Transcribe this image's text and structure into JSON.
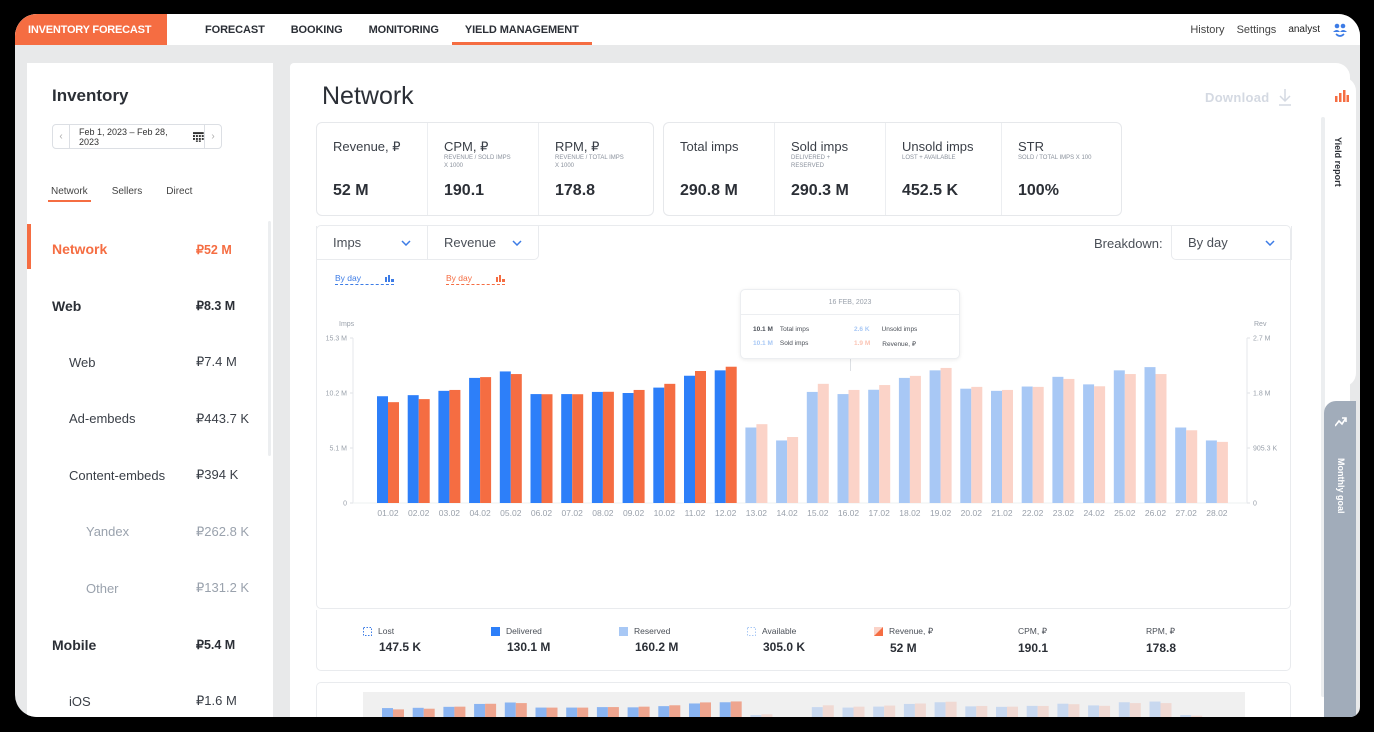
{
  "topnav": {
    "brand": "INVENTORY FORECAST",
    "tabs": [
      {
        "label": "FORECAST",
        "active": false
      },
      {
        "label": "BOOKING",
        "active": false
      },
      {
        "label": "MONITORING",
        "active": false
      },
      {
        "label": "YIELD MANAGEMENT",
        "active": true
      }
    ],
    "history": "History",
    "settings": "Settings",
    "user": "analyst",
    "user_icon": "users-icon"
  },
  "colors": {
    "accent": "#f56d42",
    "imps_actual": "#2d7ff9",
    "revenue_actual": "#f56d42",
    "imps_forecast": "#a8c8f5",
    "revenue_forecast": "#fbd3c8",
    "rail_goal": "#a1acba"
  },
  "sidebar": {
    "title": "Inventory",
    "date_range": "Feb 1, 2023 – Feb 28, 2023",
    "prev_icon": "chevron-left-icon",
    "next_icon": "chevron-right-icon",
    "calendar_icon": "calendar-icon",
    "tabs": [
      {
        "label": "Network",
        "active": true
      },
      {
        "label": "Sellers",
        "active": false
      },
      {
        "label": "Direct",
        "active": false
      }
    ],
    "items": [
      {
        "label": "Network",
        "value": "₽52 M",
        "level": 0,
        "active": true
      },
      {
        "label": "Web",
        "value": "₽8.3 M",
        "level": 0,
        "active": false
      },
      {
        "label": "Web",
        "value": "₽7.4 M",
        "level": 1,
        "active": false
      },
      {
        "label": "Ad-embeds",
        "value": "₽443.7 K",
        "level": 1,
        "active": false
      },
      {
        "label": "Content-embeds",
        "value": "₽394 K",
        "level": 1,
        "active": false
      },
      {
        "label": "Yandex",
        "value": "₽262.8 K",
        "level": 2,
        "active": false
      },
      {
        "label": "Other",
        "value": "₽131.2 K",
        "level": 2,
        "active": false
      },
      {
        "label": "Mobile",
        "value": "₽5.4 M",
        "level": 0,
        "active": false
      },
      {
        "label": "iOS",
        "value": "₽1.6 M",
        "level": 1,
        "active": false
      }
    ]
  },
  "main": {
    "title": "Network",
    "download": "Download",
    "kpi_left": [
      {
        "label": "Revenue, ₽",
        "sub": "",
        "value": "52 M"
      },
      {
        "label": "CPM, ₽",
        "sub": "REVENUE / SOLD IMPS X 1000",
        "value": "190.1"
      },
      {
        "label": "RPM, ₽",
        "sub": "REVENUE / TOTAL IMPS X 1000",
        "value": "178.8"
      }
    ],
    "kpi_right": [
      {
        "label": "Total imps",
        "sub": "",
        "value": "290.8 M"
      },
      {
        "label": "Sold imps",
        "sub": "DELIVERED + RESERVED",
        "value": "290.3 M"
      },
      {
        "label": "Unsold imps",
        "sub": "LOST + AVAILABLE",
        "value": "452.5 K"
      },
      {
        "label": "STR",
        "sub": "SOLD / TOTAL IMPS X 100",
        "value": "100%"
      }
    ],
    "selectors": {
      "metric1": "Imps",
      "metric2": "Revenue",
      "breakdown_label": "Breakdown:",
      "breakdown_value": "By day",
      "link1": "By day",
      "link2": "By day"
    },
    "tooltip": {
      "date": "16 FEB, 2023",
      "total_imps_value": "10.1 M",
      "total_imps_label": "Total imps",
      "sold_imps_value": "10.1 M",
      "sold_imps_label": "Sold imps",
      "unsold_imps_value": "2.6 K",
      "unsold_imps_label": "Unsold imps",
      "revenue_value": "1.9 M",
      "revenue_label": "Revenue, ₽"
    },
    "legend": [
      {
        "label": "Lost",
        "value": "147.5 K",
        "swatch": "dotted-blue"
      },
      {
        "label": "Delivered",
        "value": "130.1 M",
        "swatch": "solid-blue"
      },
      {
        "label": "Reserved",
        "value": "160.2 M",
        "swatch": "light-blue"
      },
      {
        "label": "Available",
        "value": "305.0 K",
        "swatch": "dotted-light"
      },
      {
        "label": "Revenue, ₽",
        "value": "52 M",
        "swatch": "orange-triangle"
      },
      {
        "label": "CPM, ₽",
        "value": "190.1",
        "swatch": "none"
      },
      {
        "label": "RPM, ₽",
        "value": "178.8",
        "swatch": "none"
      }
    ]
  },
  "rail": {
    "yield_report": "Yield report",
    "monthly_goal": "Monthly goal"
  },
  "chart_data": {
    "type": "bar",
    "title": "",
    "xlabel": "",
    "ylabel": "Imps",
    "y2label": "Rev",
    "ylim": [
      0,
      15.3
    ],
    "y2lim": [
      0,
      2.7
    ],
    "yticks": [
      "0",
      "5.1 M",
      "10.2 M",
      "15.3 M"
    ],
    "y2ticks": [
      "0",
      "905.3 K",
      "1.8 M",
      "2.7 M"
    ],
    "categories": [
      "01.02",
      "02.02",
      "03.02",
      "04.02",
      "05.02",
      "06.02",
      "07.02",
      "08.02",
      "09.02",
      "10.02",
      "11.02",
      "12.02",
      "13.02",
      "14.02",
      "15.02",
      "16.02",
      "17.02",
      "18.02",
      "19.02",
      "20.02",
      "21.02",
      "22.02",
      "23.02",
      "24.02",
      "25.02",
      "26.02",
      "27.02",
      "28.02"
    ],
    "actual_count": 12,
    "series": [
      {
        "name": "Imps (M)",
        "axis": "left",
        "values": [
          9.9,
          10.0,
          10.4,
          11.6,
          12.2,
          10.1,
          10.1,
          10.3,
          10.2,
          10.7,
          11.8,
          12.3,
          7.0,
          5.8,
          10.3,
          10.1,
          10.5,
          11.6,
          12.3,
          10.6,
          10.4,
          10.8,
          11.7,
          11.0,
          12.3,
          12.6,
          7.0,
          5.8
        ]
      },
      {
        "name": "Revenue, ₽ (M)",
        "axis": "right",
        "values": [
          1.65,
          1.7,
          1.85,
          2.06,
          2.11,
          1.78,
          1.78,
          1.82,
          1.85,
          1.95,
          2.16,
          2.23,
          1.29,
          1.08,
          1.95,
          1.85,
          1.93,
          2.08,
          2.21,
          1.9,
          1.85,
          1.9,
          2.03,
          1.91,
          2.11,
          2.11,
          1.19,
          1.0
        ]
      }
    ],
    "grid": false,
    "legend": "bottom"
  }
}
